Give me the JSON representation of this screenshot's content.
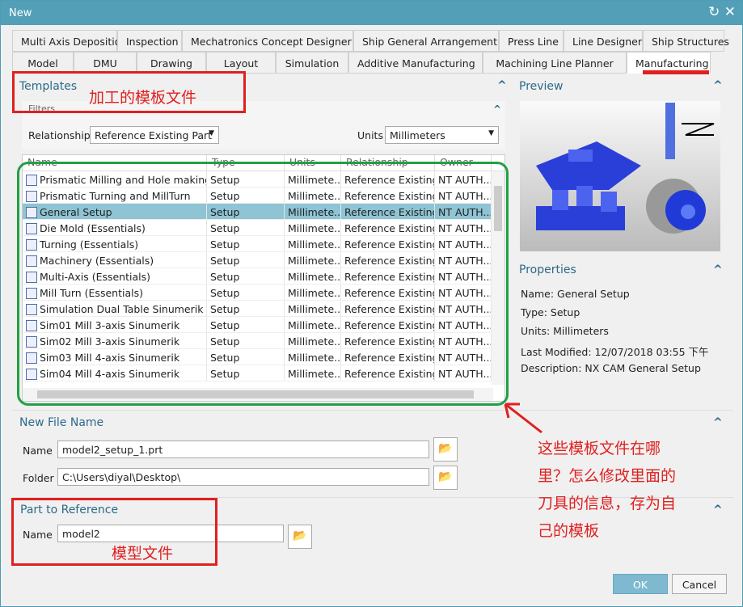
{
  "window": {
    "title": "New",
    "controls": [
      "↻",
      "✕"
    ]
  },
  "tabs_row1": [
    "Multi Axis Deposition",
    "Inspection",
    "Mechatronics Concept Designer",
    "Ship General Arrangement",
    "Press Line",
    "Line Designer",
    "Ship Structures"
  ],
  "tabs_row2": [
    "Model",
    "DMU",
    "Drawing",
    "Layout",
    "Simulation",
    "Additive Manufacturing",
    "Machining Line Planner",
    "Manufacturing"
  ],
  "templates": {
    "title": "Templates",
    "filters_title": "Filters",
    "relationship_label": "Relationship",
    "relationship_value": "Reference Existing Part",
    "units_label": "Units",
    "units_value": "Millimeters",
    "columns": [
      "Name",
      "Type",
      "Units",
      "Relationship",
      "Owner"
    ],
    "rows": [
      [
        "Prismatic Milling and Hole making",
        "Setup",
        "Millimete...",
        "Reference Existing",
        "NT AUTH..."
      ],
      [
        "Prismatic Turning and MillTurn",
        "Setup",
        "Millimete...",
        "Reference Existing",
        "NT AUTH..."
      ],
      [
        "General Setup",
        "Setup",
        "Millimete...",
        "Reference Existing",
        "NT AUTH..."
      ],
      [
        "Die Mold (Essentials)",
        "Setup",
        "Millimete...",
        "Reference Existing",
        "NT AUTH..."
      ],
      [
        "Turning (Essentials)",
        "Setup",
        "Millimete...",
        "Reference Existing",
        "NT AUTH..."
      ],
      [
        "Machinery (Essentials)",
        "Setup",
        "Millimete...",
        "Reference Existing",
        "NT AUTH..."
      ],
      [
        "Multi-Axis (Essentials)",
        "Setup",
        "Millimete...",
        "Reference Existing",
        "NT AUTH..."
      ],
      [
        "Mill Turn (Essentials)",
        "Setup",
        "Millimete...",
        "Reference Existing",
        "NT AUTH..."
      ],
      [
        "Simulation Dual Table Sinumerik",
        "Setup",
        "Millimete...",
        "Reference Existing",
        "NT AUTH..."
      ],
      [
        "Sim01 Mill 3-axis Sinumerik",
        "Setup",
        "Millimete...",
        "Reference Existing",
        "NT AUTH..."
      ],
      [
        "Sim02 Mill 3-axis Sinumerik",
        "Setup",
        "Millimete...",
        "Reference Existing",
        "NT AUTH..."
      ],
      [
        "Sim03 Mill 4-axis Sinumerik",
        "Setup",
        "Millimete...",
        "Reference Existing",
        "NT AUTH..."
      ],
      [
        "Sim04 Mill 4-axis Sinumerik",
        "Setup",
        "Millimete...",
        "Reference Existing",
        "NT AUTH..."
      ]
    ],
    "selected_index": 2
  },
  "preview": {
    "title": "Preview"
  },
  "properties": {
    "title": "Properties",
    "name": "Name: General Setup",
    "type": "Type: Setup",
    "units": "Units: Millimeters",
    "last_modified": "Last Modified: 12/07/2018 03:55 下午",
    "description": "Description: NX CAM General Setup"
  },
  "new_file": {
    "title": "New File Name",
    "name_label": "Name",
    "name_value": "model2_setup_1.prt",
    "folder_label": "Folder",
    "folder_value": "C:\\Users\\diyal\\Desktop\\"
  },
  "part_ref": {
    "title": "Part to Reference",
    "name_label": "Name",
    "name_value": "model2"
  },
  "buttons": {
    "ok": "OK",
    "cancel": "Cancel"
  },
  "annotations": {
    "templates": "加工的模板文件",
    "question": [
      "这些模板文件在哪",
      "里？怎么修改里面的",
      "刀具的信息，存为自",
      "己的模板"
    ],
    "model": "模型文件"
  },
  "colors": {
    "title_bar": "#529fb7",
    "accent": "#2b6a8a",
    "selected_row": "#8ec4d4",
    "annotation_red": "#e02020",
    "annotation_green": "#22a045",
    "ok_button": "#7fb9cf"
  }
}
